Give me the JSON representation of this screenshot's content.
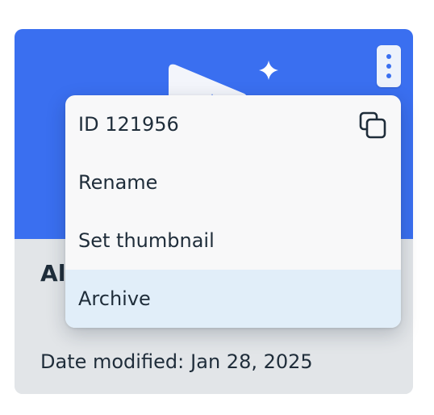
{
  "card": {
    "title_visible": "Al",
    "date_label": "Date modified:",
    "date_value": "Jan 28, 2025",
    "header_color": "#3a6ff0"
  },
  "kebab": {
    "icon": "kebab-vertical-icon"
  },
  "menu": {
    "items": [
      {
        "label": "ID 121956",
        "action_icon": "copy-icon"
      },
      {
        "label": "Rename"
      },
      {
        "label": "Set thumbnail"
      },
      {
        "label": "Archive",
        "highlighted": true
      }
    ],
    "highlight_color": "#e1eef9"
  }
}
